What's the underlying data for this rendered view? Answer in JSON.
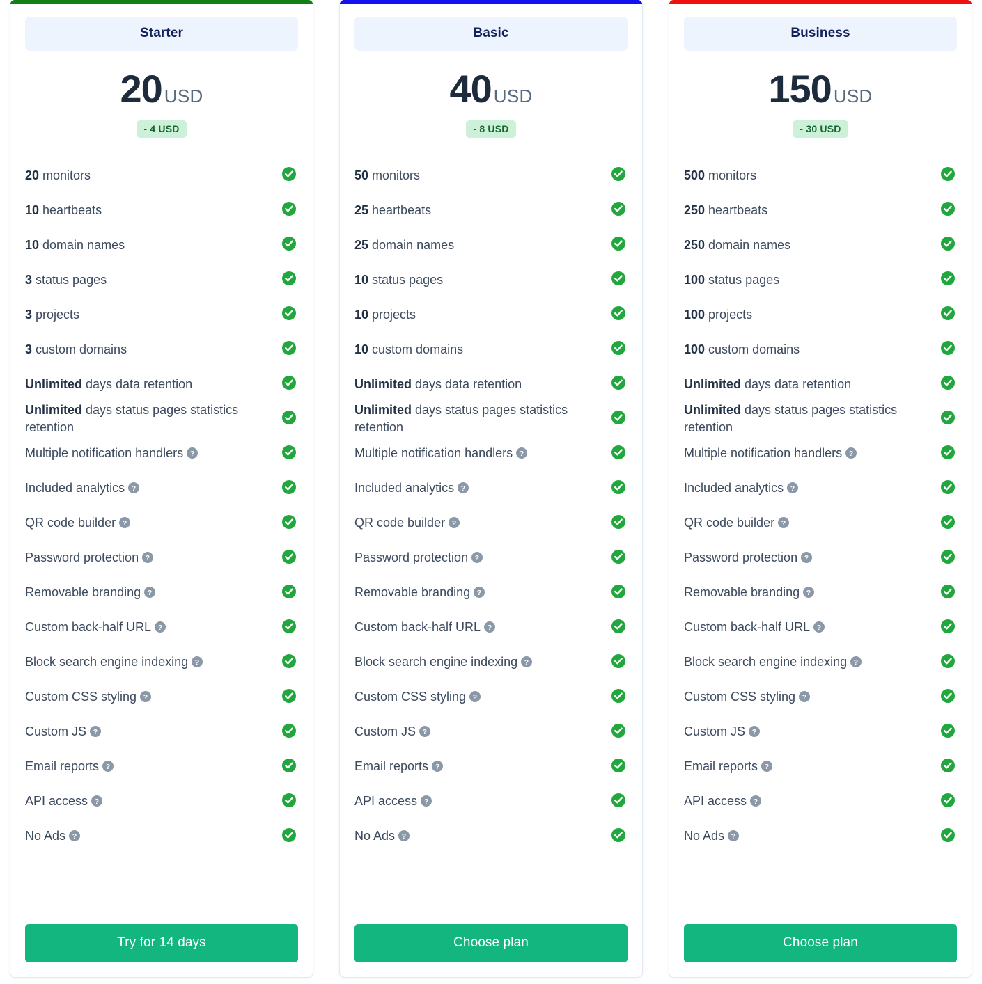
{
  "colors": {
    "starter_bar": "#0f8011",
    "basic_bar": "#1510f0",
    "business_bar": "#f01010",
    "cta": "#13b67f",
    "check": "#22a73e",
    "help": "#8b98a8",
    "plan_name_bg": "#eef4fd",
    "discount_bg": "#cdf0d8",
    "discount_text": "#14652e"
  },
  "icons": {
    "check": "check-circle-icon",
    "help": "help-circle-icon"
  },
  "plans": [
    {
      "name": "Starter",
      "price": "20",
      "currency": "USD",
      "discount": "- 4 USD",
      "accent": "#0f8011",
      "cta_label": "Try for 14 days",
      "features": [
        {
          "value": "20",
          "text": "monitors",
          "help": false
        },
        {
          "value": "10",
          "text": "heartbeats",
          "help": false
        },
        {
          "value": "10",
          "text": "domain names",
          "help": false
        },
        {
          "value": "3",
          "text": "status pages",
          "help": false
        },
        {
          "value": "3",
          "text": "projects",
          "help": false
        },
        {
          "value": "3",
          "text": "custom domains",
          "help": false
        },
        {
          "value": "Unlimited",
          "text": "days data retention",
          "help": false
        },
        {
          "value": "Unlimited",
          "text": "days status pages statistics retention",
          "help": false
        },
        {
          "value": "",
          "text": "Multiple notification handlers",
          "help": true
        },
        {
          "value": "",
          "text": "Included analytics",
          "help": true
        },
        {
          "value": "",
          "text": "QR code builder",
          "help": true
        },
        {
          "value": "",
          "text": "Password protection",
          "help": true
        },
        {
          "value": "",
          "text": "Removable branding",
          "help": true
        },
        {
          "value": "",
          "text": "Custom back-half URL",
          "help": true
        },
        {
          "value": "",
          "text": "Block search engine indexing",
          "help": true
        },
        {
          "value": "",
          "text": "Custom CSS styling",
          "help": true
        },
        {
          "value": "",
          "text": "Custom JS",
          "help": true
        },
        {
          "value": "",
          "text": "Email reports",
          "help": true
        },
        {
          "value": "",
          "text": "API access",
          "help": true
        },
        {
          "value": "",
          "text": "No Ads",
          "help": true
        }
      ]
    },
    {
      "name": "Basic",
      "price": "40",
      "currency": "USD",
      "discount": "- 8 USD",
      "accent": "#1510f0",
      "cta_label": "Choose plan",
      "features": [
        {
          "value": "50",
          "text": "monitors",
          "help": false
        },
        {
          "value": "25",
          "text": "heartbeats",
          "help": false
        },
        {
          "value": "25",
          "text": "domain names",
          "help": false
        },
        {
          "value": "10",
          "text": "status pages",
          "help": false
        },
        {
          "value": "10",
          "text": "projects",
          "help": false
        },
        {
          "value": "10",
          "text": "custom domains",
          "help": false
        },
        {
          "value": "Unlimited",
          "text": "days data retention",
          "help": false
        },
        {
          "value": "Unlimited",
          "text": "days status pages statistics retention",
          "help": false
        },
        {
          "value": "",
          "text": "Multiple notification handlers",
          "help": true
        },
        {
          "value": "",
          "text": "Included analytics",
          "help": true
        },
        {
          "value": "",
          "text": "QR code builder",
          "help": true
        },
        {
          "value": "",
          "text": "Password protection",
          "help": true
        },
        {
          "value": "",
          "text": "Removable branding",
          "help": true
        },
        {
          "value": "",
          "text": "Custom back-half URL",
          "help": true
        },
        {
          "value": "",
          "text": "Block search engine indexing",
          "help": true
        },
        {
          "value": "",
          "text": "Custom CSS styling",
          "help": true
        },
        {
          "value": "",
          "text": "Custom JS",
          "help": true
        },
        {
          "value": "",
          "text": "Email reports",
          "help": true
        },
        {
          "value": "",
          "text": "API access",
          "help": true
        },
        {
          "value": "",
          "text": "No Ads",
          "help": true
        }
      ]
    },
    {
      "name": "Business",
      "price": "150",
      "currency": "USD",
      "discount": "- 30 USD",
      "accent": "#f01010",
      "cta_label": "Choose plan",
      "features": [
        {
          "value": "500",
          "text": "monitors",
          "help": false
        },
        {
          "value": "250",
          "text": "heartbeats",
          "help": false
        },
        {
          "value": "250",
          "text": "domain names",
          "help": false
        },
        {
          "value": "100",
          "text": "status pages",
          "help": false
        },
        {
          "value": "100",
          "text": "projects",
          "help": false
        },
        {
          "value": "100",
          "text": "custom domains",
          "help": false
        },
        {
          "value": "Unlimited",
          "text": "days data retention",
          "help": false
        },
        {
          "value": "Unlimited",
          "text": "days status pages statistics retention",
          "help": false
        },
        {
          "value": "",
          "text": "Multiple notification handlers",
          "help": true
        },
        {
          "value": "",
          "text": "Included analytics",
          "help": true
        },
        {
          "value": "",
          "text": "QR code builder",
          "help": true
        },
        {
          "value": "",
          "text": "Password protection",
          "help": true
        },
        {
          "value": "",
          "text": "Removable branding",
          "help": true
        },
        {
          "value": "",
          "text": "Custom back-half URL",
          "help": true
        },
        {
          "value": "",
          "text": "Block search engine indexing",
          "help": true
        },
        {
          "value": "",
          "text": "Custom CSS styling",
          "help": true
        },
        {
          "value": "",
          "text": "Custom JS",
          "help": true
        },
        {
          "value": "",
          "text": "Email reports",
          "help": true
        },
        {
          "value": "",
          "text": "API access",
          "help": true
        },
        {
          "value": "",
          "text": "No Ads",
          "help": true
        }
      ]
    }
  ]
}
